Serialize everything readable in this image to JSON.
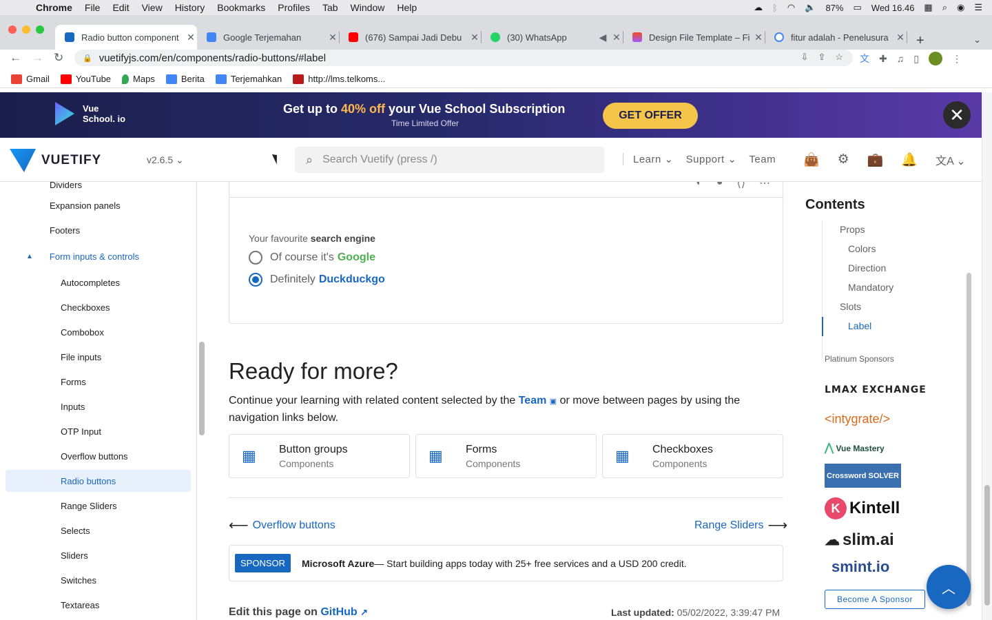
{
  "menubar": {
    "app": "Chrome",
    "items": [
      "File",
      "Edit",
      "View",
      "History",
      "Bookmarks",
      "Profiles",
      "Tab",
      "Window",
      "Help"
    ],
    "battery": "87%",
    "clock": "Wed 16.46"
  },
  "tabs": [
    {
      "title": "Radio button component",
      "active": true
    },
    {
      "title": "Google Terjemahan"
    },
    {
      "title": "(676) Sampai Jadi Debu"
    },
    {
      "title": "(30) WhatsApp"
    },
    {
      "title": "Design File Template – Fi"
    },
    {
      "title": "fitur adalah - Penelusura"
    }
  ],
  "url": "vuetifyjs.com/en/components/radio-buttons/#label",
  "bookmarks": [
    "Gmail",
    "YouTube",
    "Maps",
    "Berita",
    "Terjemahkan",
    "http://lms.telkoms..."
  ],
  "banner": {
    "brand": "Vue School. io",
    "headline_pre": "Get up to ",
    "headline_hl": "40% off",
    "headline_post": " your Vue School Subscription",
    "sub": "Time Limited Offer",
    "cta": "GET OFFER"
  },
  "appbar": {
    "brand": "VUETIFY",
    "version": "v2.6.5",
    "search_placeholder": "Search Vuetify (press /)",
    "nav": [
      "Learn",
      "Support",
      "Team"
    ]
  },
  "sidebar": {
    "items": [
      {
        "label": "Dividers",
        "level": 1
      },
      {
        "label": "Expansion panels",
        "level": 1
      },
      {
        "label": "Footers",
        "level": 1
      },
      {
        "label": "Form inputs & controls",
        "level": 1,
        "group": true
      },
      {
        "label": "Autocompletes",
        "level": 2
      },
      {
        "label": "Checkboxes",
        "level": 2
      },
      {
        "label": "Combobox",
        "level": 2
      },
      {
        "label": "File inputs",
        "level": 2
      },
      {
        "label": "Forms",
        "level": 2
      },
      {
        "label": "Inputs",
        "level": 2
      },
      {
        "label": "OTP Input",
        "level": 2
      },
      {
        "label": "Overflow buttons",
        "level": 2
      },
      {
        "label": "Radio buttons",
        "level": 2,
        "active": true
      },
      {
        "label": "Range Sliders",
        "level": 2
      },
      {
        "label": "Selects",
        "level": 2
      },
      {
        "label": "Sliders",
        "level": 2
      },
      {
        "label": "Switches",
        "level": 2
      },
      {
        "label": "Textareas",
        "level": 2
      }
    ]
  },
  "example": {
    "label_pre": "Your favourite ",
    "label_bold": "search engine",
    "options": [
      {
        "pre": "Of course it's",
        "strong": "Google",
        "color": "#4caf50",
        "selected": false
      },
      {
        "pre": "Definitely",
        "strong": "Duckduckgo",
        "color": "#1867c0",
        "selected": true
      }
    ]
  },
  "more": {
    "heading": "Ready for more?",
    "para_pre": "Continue your learning with related content selected by the ",
    "para_link": "Team",
    "para_post": " or move between pages by using the navigation links below.",
    "cards": [
      {
        "title": "Button groups",
        "subtitle": "Components"
      },
      {
        "title": "Forms",
        "subtitle": "Components"
      },
      {
        "title": "Checkboxes",
        "subtitle": "Components"
      }
    ],
    "prev": "Overflow buttons",
    "next": "Range Sliders"
  },
  "sponsor_bar": {
    "tag": "SPONSOR",
    "name": "Microsoft Azure",
    "text": " — Start building apps today with 25+ free services and a USD 200 credit."
  },
  "footer": {
    "edit_pre": "Edit this page on ",
    "edit_link": "GitHub",
    "updated_label": "Last updated:",
    "updated_value": "05/02/2022, 3:39:47 PM"
  },
  "toc": {
    "title": "Contents",
    "items": [
      {
        "label": "Props",
        "level": 1
      },
      {
        "label": "Colors",
        "level": 2
      },
      {
        "label": "Direction",
        "level": 2
      },
      {
        "label": "Mandatory",
        "level": 2
      },
      {
        "label": "Slots",
        "level": 1
      },
      {
        "label": "Label",
        "level": 2,
        "active": true
      }
    ],
    "sponsors_heading": "Platinum Sponsors",
    "sponsors": [
      "LMAX EXCHANGE",
      "<intygrate/>",
      "Vue Mastery",
      "Crossword SOLVER",
      "Kintell",
      "slim.ai",
      "smint.io"
    ],
    "become": "Become A Sponsor"
  },
  "colors": {
    "primary": "#1867c0",
    "google_green": "#4caf50"
  }
}
